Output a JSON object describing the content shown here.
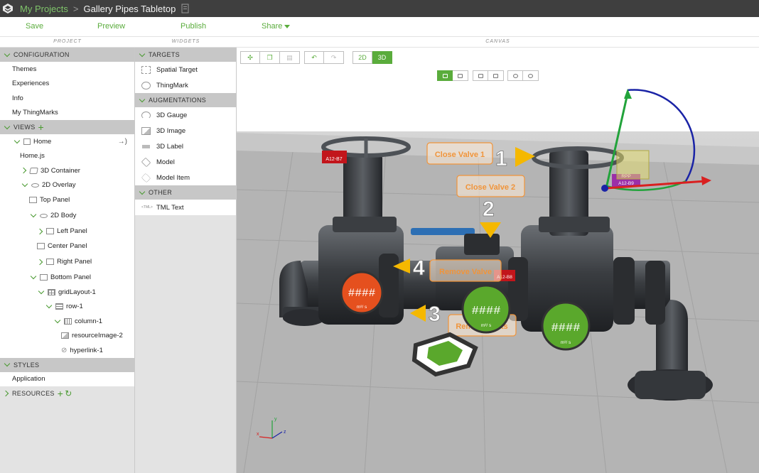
{
  "titlebar": {
    "breadcrumb_link": "My Projects",
    "separator": ">",
    "project_title": "Gallery Pipes Tabletop"
  },
  "toolbar": {
    "save": "Save",
    "preview": "Preview",
    "publish": "Publish",
    "share": "Share"
  },
  "panels": {
    "project": "PROJECT",
    "widgets": "WIDGETS",
    "canvas": "CANVAS"
  },
  "project": {
    "configuration": "CONFIGURATION",
    "config_items": [
      "Themes",
      "Experiences",
      "Info",
      "My ThingMarks"
    ],
    "views": "VIEWS",
    "tree": {
      "home": "Home",
      "home_js": "Home.js",
      "container3d": "3D Container",
      "overlay2d": "2D Overlay",
      "top_panel": "Top Panel",
      "body2d": "2D Body",
      "left_panel": "Left Panel",
      "center_panel": "Center Panel",
      "right_panel": "Right Panel",
      "bottom_panel": "Bottom Panel",
      "grid_layout": "gridLayout-1",
      "row": "row-1",
      "column": "column-1",
      "resource_image": "resourceImage-2",
      "hyperlink": "hyperlink-1"
    },
    "styles": "STYLES",
    "application": "Application",
    "resources": "RESOURCES"
  },
  "widgets": {
    "targets": "TARGETS",
    "target_items": [
      "Spatial Target",
      "ThingMark"
    ],
    "augmentations": "AUGMENTATIONS",
    "augmentation_items": [
      "3D Gauge",
      "3D Image",
      "3D Label",
      "Model",
      "Model Item"
    ],
    "other": "OTHER",
    "other_items": [
      "TML Text"
    ]
  },
  "canvas": {
    "mode_2d": "2D",
    "mode_3d": "3D",
    "active_mode": "3D",
    "labels": {
      "close_valve_1": "Close Valve 1",
      "close_valve_2": "Close Valve 2",
      "remove_valve": "Remove Valve",
      "remove_bolts": "Remove Bolts",
      "step1": "1",
      "step2": "2",
      "step3": "3",
      "step4": "4",
      "tag_a12_b7": "A12-B7",
      "tag_a12_b8": "A12-B8",
      "tag_a12_b9": "A12-B9",
      "tag_rpp": "RPP",
      "gauge_unit": "m³/ s",
      "axis_x": "x",
      "axis_y": "y",
      "axis_z": "z"
    },
    "colors": {
      "accent": "#5aac3c",
      "label_orange": "#f0943a",
      "arrow_yellow": "#f5b800",
      "gauge_red": "#e5501e",
      "gauge_green": "#5aa82c"
    }
  }
}
